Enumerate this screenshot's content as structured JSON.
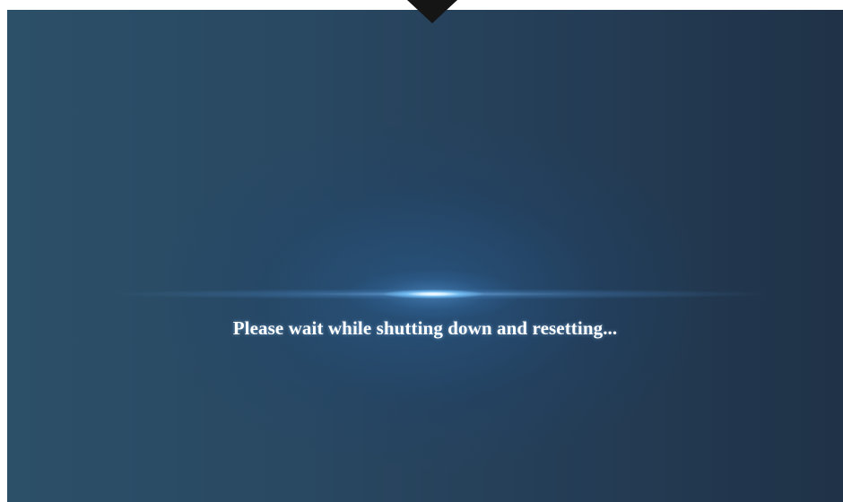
{
  "screen": {
    "status_message": "Please wait while shutting down and resetting...",
    "background_color": "#253e57",
    "accent_glow_color": "#8cc8ff"
  },
  "icons": {
    "top_indicator": "down-triangle-icon"
  }
}
